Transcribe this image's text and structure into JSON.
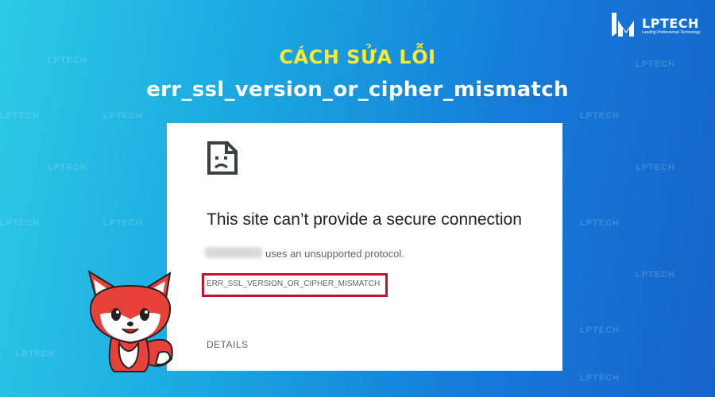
{
  "brand": {
    "name": "LPTECH",
    "tagline": "Leading Professional Technology",
    "watermark": "LPTECH"
  },
  "banner": {
    "title_line1": "CÁCH SỬA LỖI",
    "title_line2": "err_ssl_version_or_cipher_mismatch",
    "title_line1_color": "#ffe930",
    "title_line2_color": "#ffffff"
  },
  "browser_error": {
    "icon": "sad-page-icon",
    "heading": "This site can’t provide a secure connection",
    "message": "uses an unsupported protocol.",
    "error_code": "ERR_SSL_VERSION_OR_CIPHER_MISMATCH",
    "details_link": "DETAILS",
    "highlight_color": "#c8102e"
  },
  "mascot": {
    "icon": "fox-mascot-icon"
  }
}
